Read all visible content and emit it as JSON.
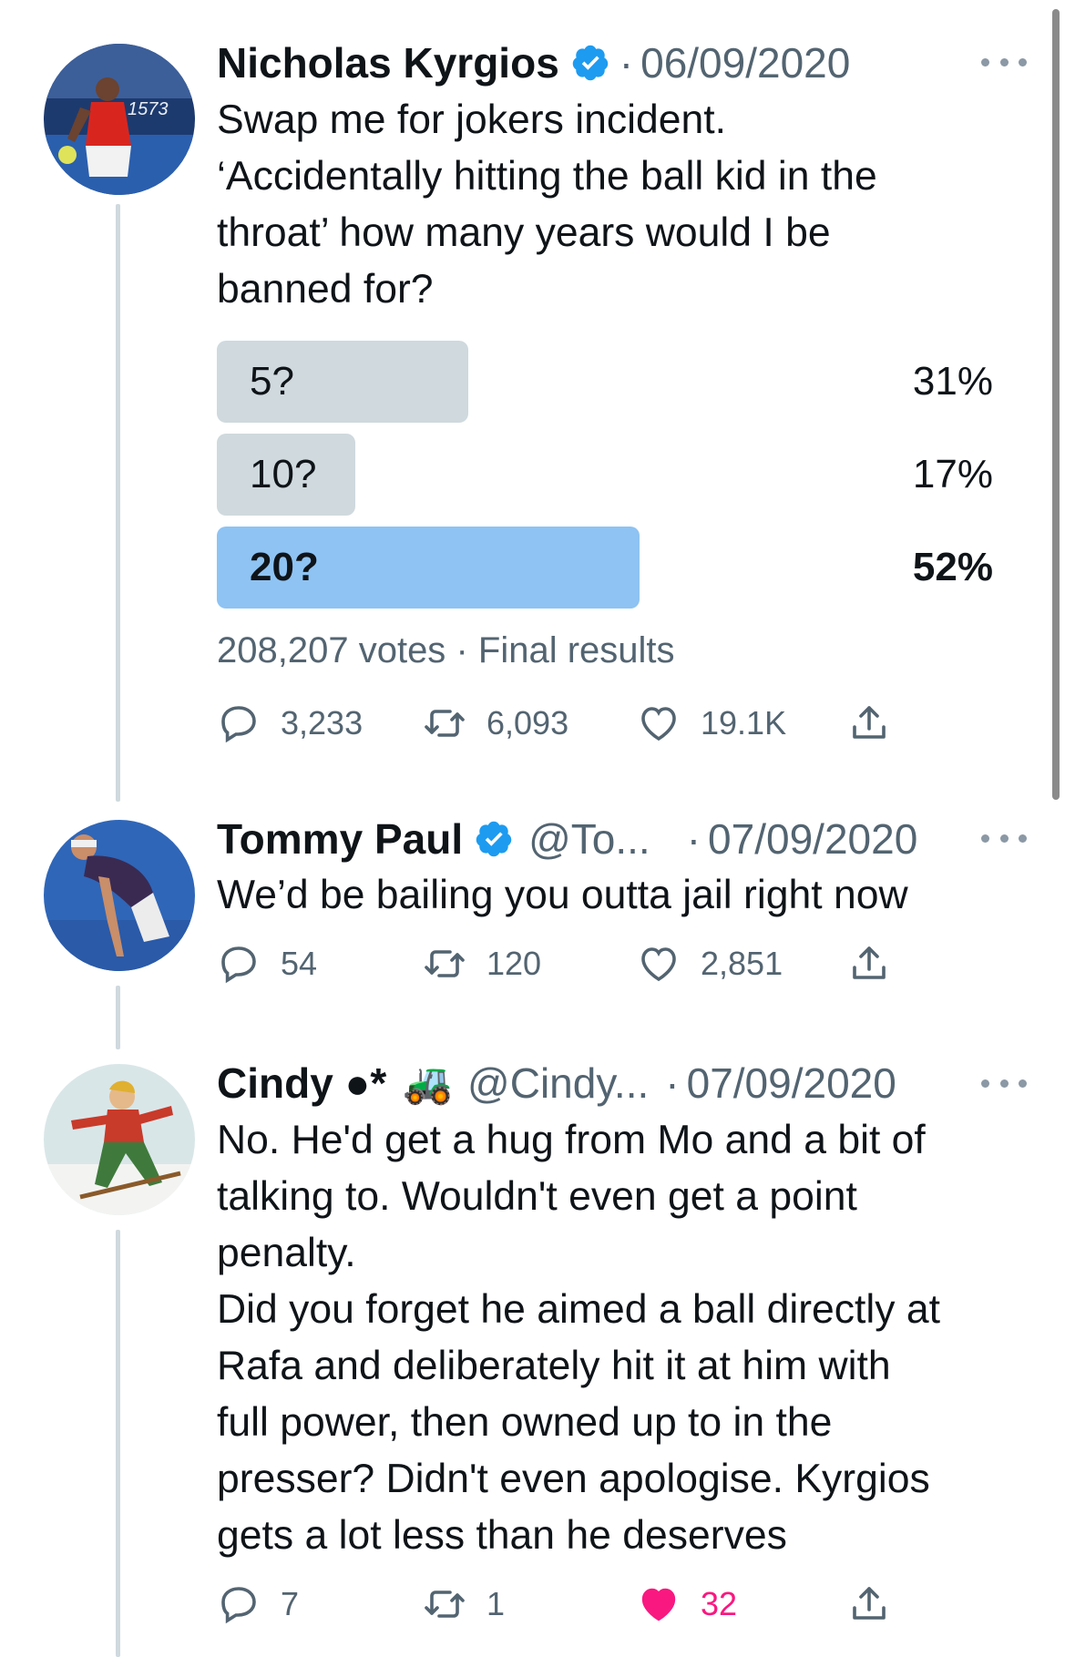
{
  "tweets": [
    {
      "name": "Nicholas Kyrgios",
      "handle": "",
      "date": "06/09/2020",
      "text": [
        "Swap me for jokers incident.",
        "‘Accidentally hitting the ball kid in the",
        "throat’ how many years would I be",
        "banned for?"
      ],
      "poll": {
        "options": [
          {
            "label": "5?",
            "percent": 31,
            "pct_text": "31%",
            "winner": false
          },
          {
            "label": "10?",
            "percent": 17,
            "pct_text": "17%",
            "winner": false
          },
          {
            "label": "20?",
            "percent": 52,
            "pct_text": "52%",
            "winner": true
          }
        ],
        "votes": "208,207 votes",
        "status": "Final results"
      },
      "stats": {
        "replies": "3,233",
        "retweets": "6,093",
        "likes": "19.1K"
      }
    },
    {
      "name": "Tommy Paul",
      "handle": "@To...",
      "date": "07/09/2020",
      "text": [
        "We’d be bailing you outta jail right now"
      ],
      "stats": {
        "replies": "54",
        "retweets": "120",
        "likes": "2,851"
      }
    },
    {
      "name": "Cindy ●*",
      "emoji": "🚜",
      "handle": "@Cindy...",
      "date": "07/09/2020",
      "text": [
        "No. He'd get a hug from Mo and a bit of",
        "talking to. Wouldn't even get a point",
        "penalty.",
        "Did you forget he aimed a ball directly at",
        "Rafa and deliberately hit it at him with",
        "full power, then owned up to in the",
        "presser? Didn't even apologise. Kyrgios",
        "gets a lot less than he deserves"
      ],
      "stats": {
        "replies": "7",
        "retweets": "1",
        "likes": "32",
        "liked": true
      }
    }
  ],
  "separator": "·",
  "colors": {
    "accent": "#1d9bf0",
    "poll_winner": "#8ec3f3",
    "poll_other": "#cfd9de",
    "like": "#f91880",
    "muted": "#536471"
  },
  "icons": [
    "verified-badge-icon",
    "more-icon",
    "reply-icon",
    "retweet-icon",
    "like-icon",
    "share-icon",
    "tractor-emoji"
  ]
}
